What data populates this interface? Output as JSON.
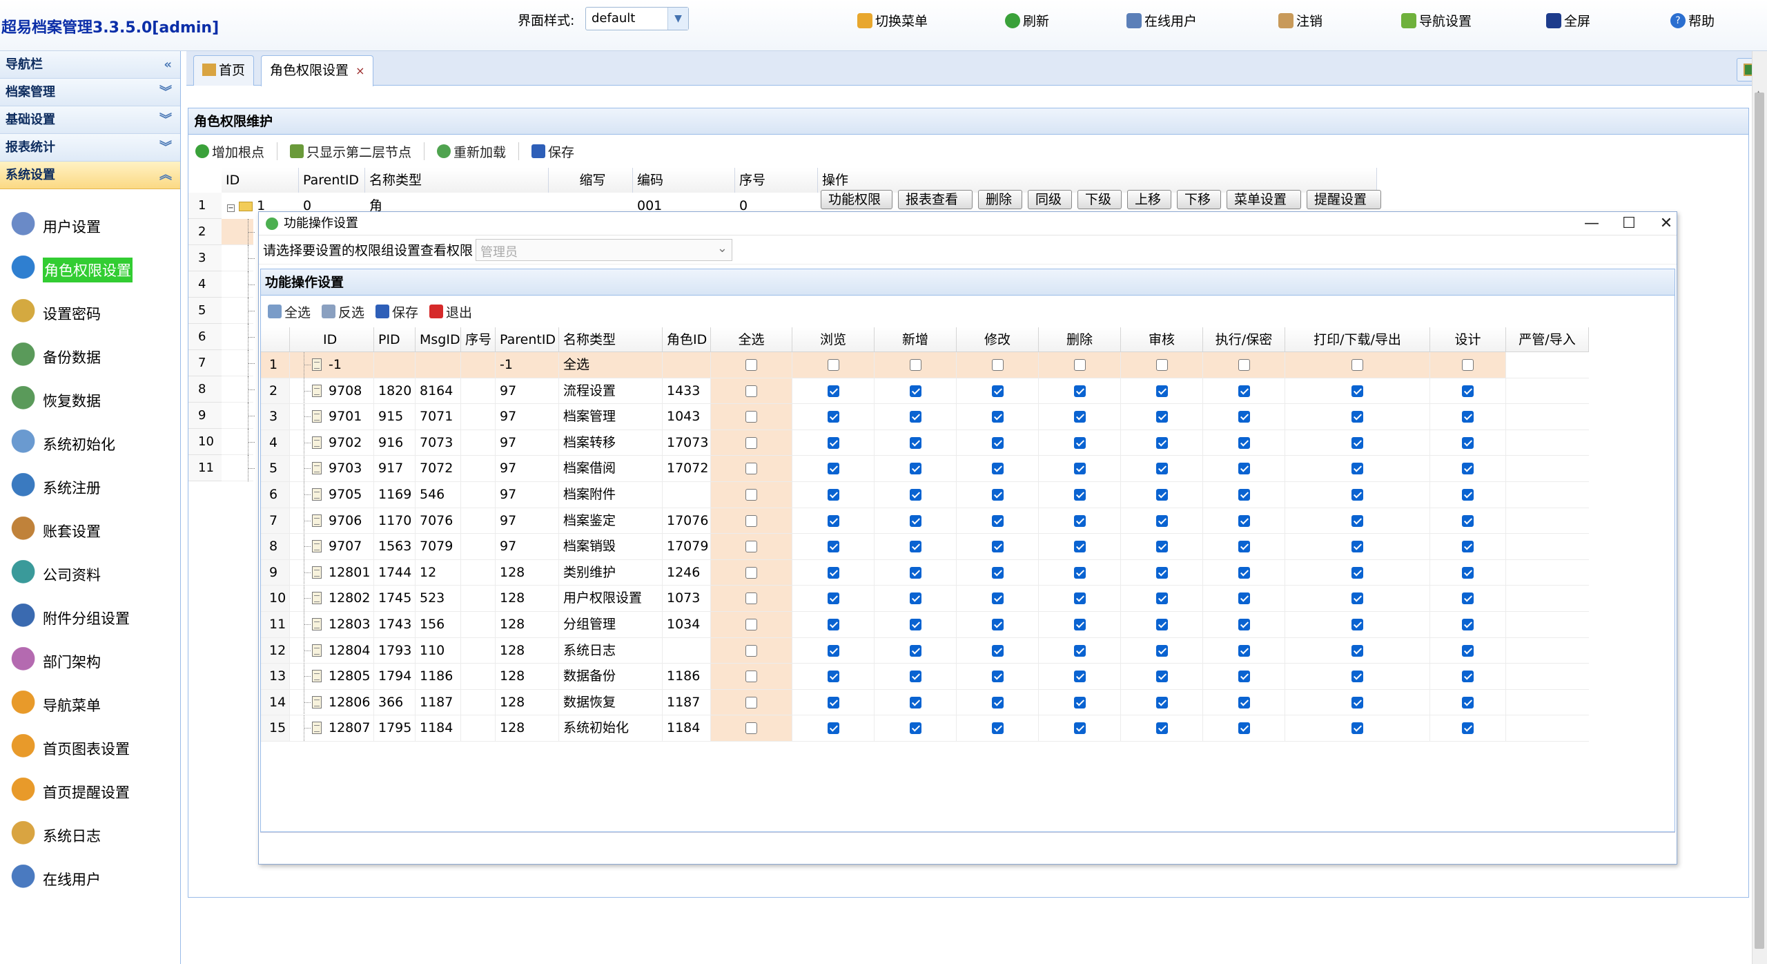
{
  "header": {
    "app_title": "超易档案管理3.3.5.0[admin]",
    "theme_label": "界面样式:",
    "theme_value": "default",
    "links": {
      "switch_menu": "切换菜单",
      "refresh": "刷新",
      "online_users": "在线用户",
      "logout": "注销",
      "nav_settings": "导航设置",
      "fullscreen": "全屏",
      "help": "帮助"
    }
  },
  "sidebar": {
    "nav_title": "导航栏",
    "groups": {
      "archive": "档案管理",
      "basic": "基础设置",
      "report": "报表统计",
      "system": "系统设置"
    },
    "items": [
      {
        "label": "用户设置",
        "icon": "users-icon"
      },
      {
        "label": "角色权限设置",
        "icon": "role-icon"
      },
      {
        "label": "设置密码",
        "icon": "key-icon"
      },
      {
        "label": "备份数据",
        "icon": "db-backup-icon"
      },
      {
        "label": "恢复数据",
        "icon": "db-restore-icon"
      },
      {
        "label": "系统初始化",
        "icon": "init-icon"
      },
      {
        "label": "系统注册",
        "icon": "register-icon"
      },
      {
        "label": "账套设置",
        "icon": "tools-icon"
      },
      {
        "label": "公司资料",
        "icon": "book-icon"
      },
      {
        "label": "附件分组设置",
        "icon": "group-icon"
      },
      {
        "label": "部门架构",
        "icon": "dept-icon"
      },
      {
        "label": "导航菜单",
        "icon": "factory-icon"
      },
      {
        "label": "首页图表设置",
        "icon": "factory-icon"
      },
      {
        "label": "首页提醒设置",
        "icon": "factory-icon"
      },
      {
        "label": "系统日志",
        "icon": "log-icon"
      },
      {
        "label": "在线用户",
        "icon": "online-icon"
      }
    ]
  },
  "tabs": {
    "home": "首页",
    "role": "角色权限设置",
    "close": "×"
  },
  "panel": {
    "title": "角色权限维护",
    "toolbar": {
      "add_root": "增加根点",
      "show_second": "只显示第二层节点",
      "reload": "重新加载",
      "save": "保存"
    },
    "headers": {
      "id": "ID",
      "parent_id": "ParentID",
      "name_type": "名称类型",
      "abbr": "缩写",
      "code": "编码",
      "seq": "序号",
      "action": "操作"
    },
    "first_row": {
      "rownum": "1",
      "id": "1",
      "parent_id": "0",
      "name": "角色权限组",
      "code": "001",
      "seq": "0"
    },
    "row_numbers": [
      "2",
      "3",
      "4",
      "5",
      "6",
      "7",
      "8",
      "9",
      "10",
      "11"
    ],
    "action_buttons": [
      "功能权限",
      "报表查看",
      "删除",
      "同级",
      "下级",
      "上移",
      "下移",
      "菜单设置",
      "提醒设置"
    ]
  },
  "modal": {
    "title": "功能操作设置",
    "filter_label": "请选择要设置的权限组设置查看权限",
    "filter_placeholder": "管理员",
    "section_title": "功能操作设置",
    "toolbar": {
      "select_all": "全选",
      "invert": "反选",
      "save": "保存",
      "exit": "退出"
    },
    "columns": [
      "ID",
      "PID",
      "MsgID",
      "序号",
      "ParentID",
      "名称类型",
      "角色ID",
      "全选",
      "浏览",
      "新增",
      "修改",
      "删除",
      "审核",
      "执行/保密",
      "打印/下载/导出",
      "设计",
      "严管/导入"
    ],
    "rows": [
      {
        "n": "1",
        "id": "-1",
        "pid": "",
        "msgid": "",
        "parent": "-1",
        "name": "全选",
        "role": "",
        "checked": false
      },
      {
        "n": "2",
        "id": "9708",
        "pid": "1820",
        "msgid": "8164",
        "parent": "97",
        "name": "流程设置",
        "role": "1433",
        "checked": true
      },
      {
        "n": "3",
        "id": "9701",
        "pid": "915",
        "msgid": "7071",
        "parent": "97",
        "name": "档案管理",
        "role": "1043",
        "checked": true
      },
      {
        "n": "4",
        "id": "9702",
        "pid": "916",
        "msgid": "7073",
        "parent": "97",
        "name": "档案转移",
        "role": "17073",
        "checked": true
      },
      {
        "n": "5",
        "id": "9703",
        "pid": "917",
        "msgid": "7072",
        "parent": "97",
        "name": "档案借阅",
        "role": "17072",
        "checked": true
      },
      {
        "n": "6",
        "id": "9705",
        "pid": "1169",
        "msgid": "546",
        "parent": "97",
        "name": "档案附件",
        "role": "",
        "checked": true
      },
      {
        "n": "7",
        "id": "9706",
        "pid": "1170",
        "msgid": "7076",
        "parent": "97",
        "name": "档案鉴定",
        "role": "17076",
        "checked": true
      },
      {
        "n": "8",
        "id": "9707",
        "pid": "1563",
        "msgid": "7079",
        "parent": "97",
        "name": "档案销毁",
        "role": "17079",
        "checked": true
      },
      {
        "n": "9",
        "id": "12801",
        "pid": "1744",
        "msgid": "12",
        "parent": "128",
        "name": "类别维护",
        "role": "1246",
        "checked": true
      },
      {
        "n": "10",
        "id": "12802",
        "pid": "1745",
        "msgid": "523",
        "parent": "128",
        "name": "用户权限设置",
        "role": "1073",
        "checked": true
      },
      {
        "n": "11",
        "id": "12803",
        "pid": "1743",
        "msgid": "156",
        "parent": "128",
        "name": "分组管理",
        "role": "1034",
        "checked": true
      },
      {
        "n": "12",
        "id": "12804",
        "pid": "1793",
        "msgid": "110",
        "parent": "128",
        "name": "系统日志",
        "role": "",
        "checked": true
      },
      {
        "n": "13",
        "id": "12805",
        "pid": "1794",
        "msgid": "1186",
        "parent": "128",
        "name": "数据备份",
        "role": "1186",
        "checked": true
      },
      {
        "n": "14",
        "id": "12806",
        "pid": "366",
        "msgid": "1187",
        "parent": "128",
        "name": "数据恢复",
        "role": "1187",
        "checked": true
      },
      {
        "n": "15",
        "id": "12807",
        "pid": "1795",
        "msgid": "1184",
        "parent": "128",
        "name": "系统初始化",
        "role": "1184",
        "checked": true
      }
    ]
  }
}
